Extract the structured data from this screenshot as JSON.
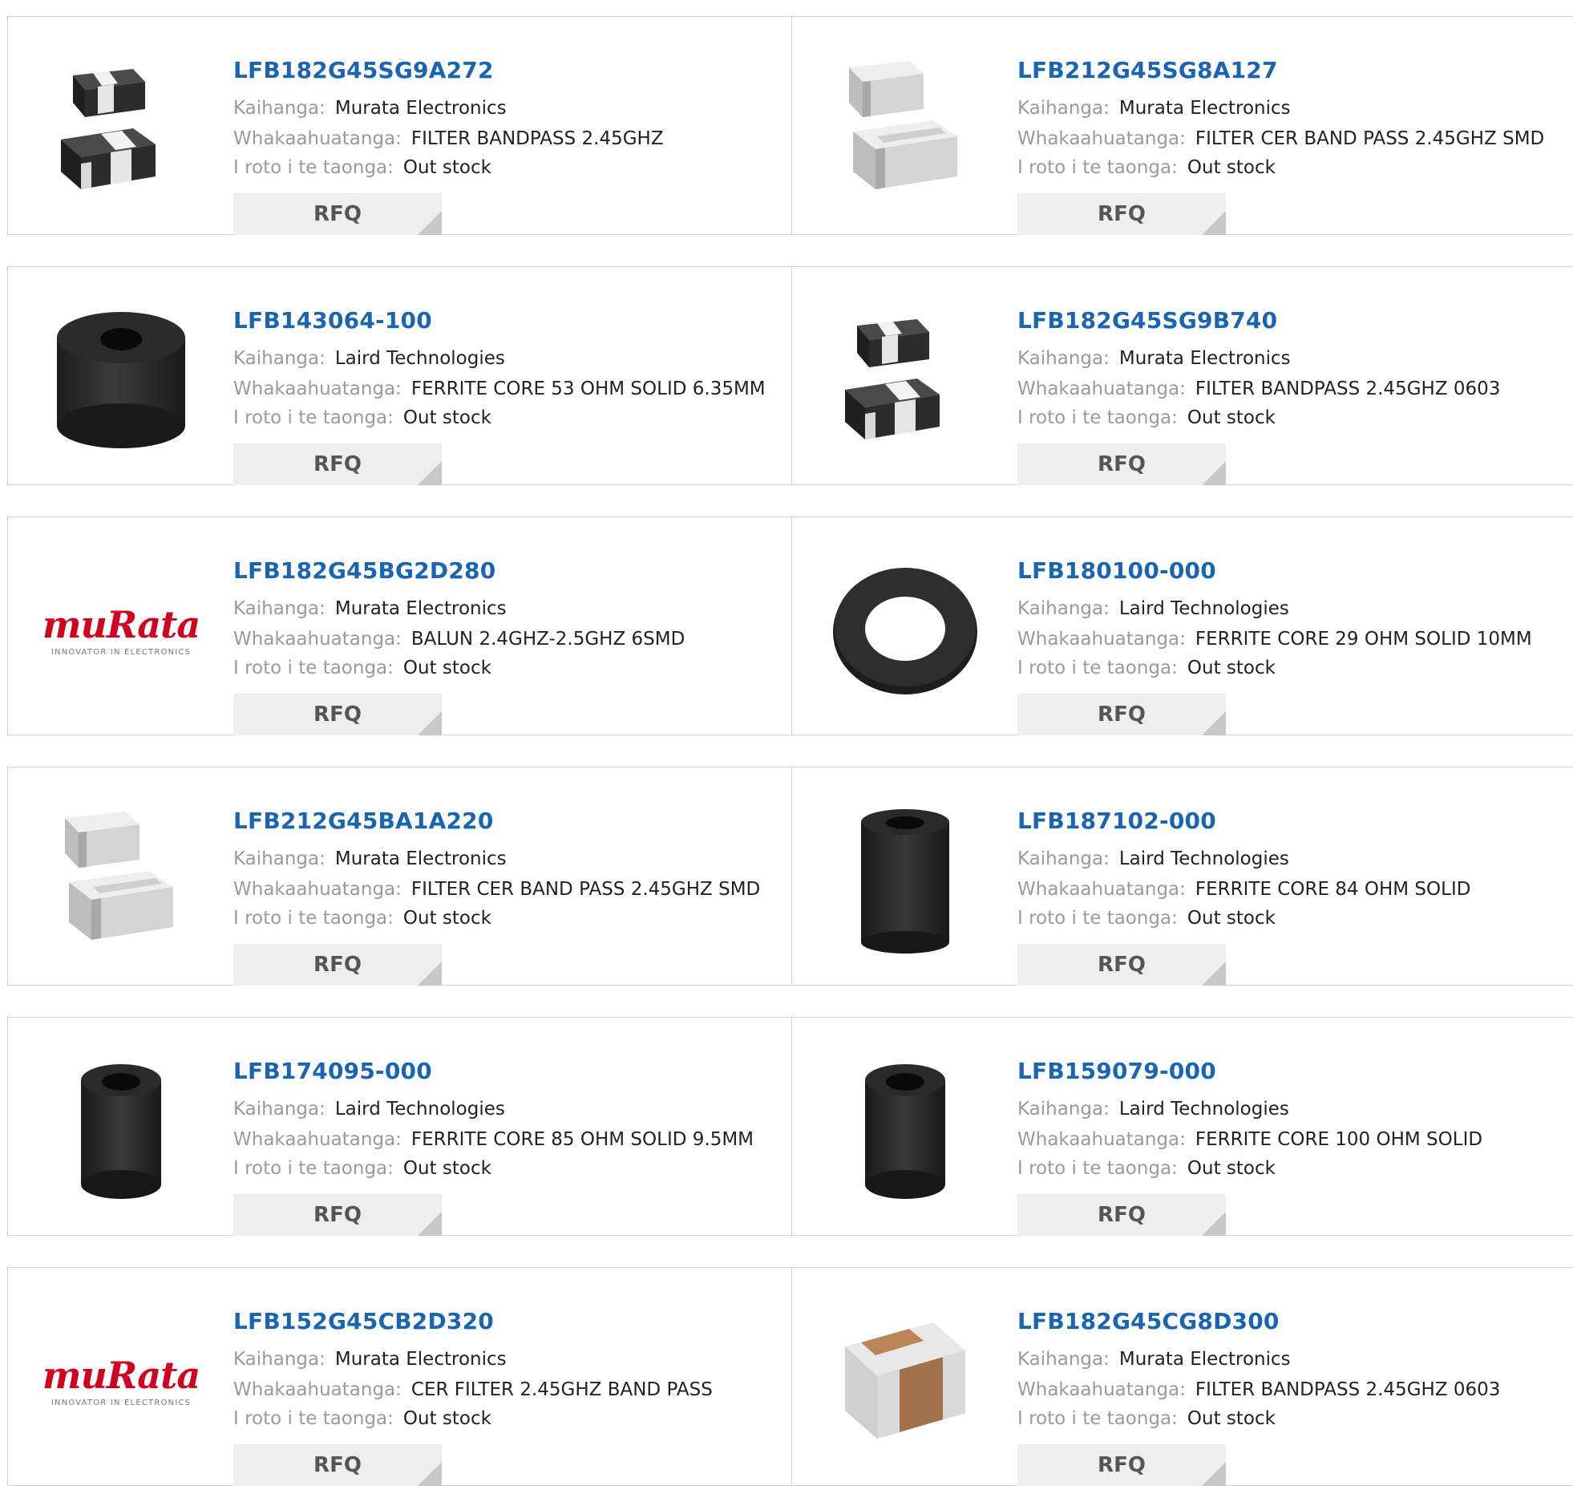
{
  "labels": {
    "manufacturer": "Kaihanga:",
    "description": "Whakaahuatanga:",
    "stock": "I roto i te taonga:",
    "rfq": "RFQ"
  },
  "logo": {
    "word": "muRata",
    "tagline": "INNOVATOR IN ELECTRONICS"
  },
  "products": [
    {
      "part": "LFB182G45SG9A272",
      "manufacturer": "Murata Electronics",
      "description": "FILTER BANDPASS 2.45GHZ",
      "stock": "Out stock",
      "image": "black-smd-chip-pair"
    },
    {
      "part": "LFB212G45SG8A127",
      "manufacturer": "Murata Electronics",
      "description": "FILTER CER BAND PASS 2.45GHZ SMD",
      "stock": "Out stock",
      "image": "grey-smd-chip-pair"
    },
    {
      "part": "LFB143064-100",
      "manufacturer": "Laird Technologies",
      "description": "FERRITE CORE 53 OHM SOLID 6.35MM",
      "stock": "Out stock",
      "image": "ferrite-core-short"
    },
    {
      "part": "LFB182G45SG9B740",
      "manufacturer": "Murata Electronics",
      "description": "FILTER BANDPASS 2.45GHZ 0603",
      "stock": "Out stock",
      "image": "black-smd-chip-pair"
    },
    {
      "part": "LFB182G45BG2D280",
      "manufacturer": "Murata Electronics",
      "description": "BALUN 2.4GHZ-2.5GHZ 6SMD",
      "stock": "Out stock",
      "image": "murata-logo"
    },
    {
      "part": "LFB180100-000",
      "manufacturer": "Laird Technologies",
      "description": "FERRITE CORE 29 OHM SOLID 10MM",
      "stock": "Out stock",
      "image": "ferrite-ring"
    },
    {
      "part": "LFB212G45BA1A220",
      "manufacturer": "Murata Electronics",
      "description": "FILTER CER BAND PASS 2.45GHZ SMD",
      "stock": "Out stock",
      "image": "grey-smd-chip-pair"
    },
    {
      "part": "LFB187102-000",
      "manufacturer": "Laird Technologies",
      "description": "FERRITE CORE 84 OHM SOLID",
      "stock": "Out stock",
      "image": "ferrite-core-tall"
    },
    {
      "part": "LFB174095-000",
      "manufacturer": "Laird Technologies",
      "description": "FERRITE CORE 85 OHM SOLID 9.5MM",
      "stock": "Out stock",
      "image": "ferrite-core-medium"
    },
    {
      "part": "LFB159079-000",
      "manufacturer": "Laird Technologies",
      "description": "FERRITE CORE 100 OHM SOLID",
      "stock": "Out stock",
      "image": "ferrite-core-medium"
    },
    {
      "part": "LFB152G45CB2D320",
      "manufacturer": "Murata Electronics",
      "description": "CER FILTER 2.45GHZ BAND PASS",
      "stock": "Out stock",
      "image": "murata-logo"
    },
    {
      "part": "LFB182G45CG8D300",
      "manufacturer": "Murata Electronics",
      "description": "FILTER BANDPASS 2.45GHZ 0603",
      "stock": "Out stock",
      "image": "ceramic-chip-brown"
    }
  ],
  "colors": {
    "link": "#1a65b2",
    "label": "#9a9a9a",
    "button_bg": "#eeeeee",
    "border": "#d4d4d4",
    "logo_red": "#d2001f"
  }
}
